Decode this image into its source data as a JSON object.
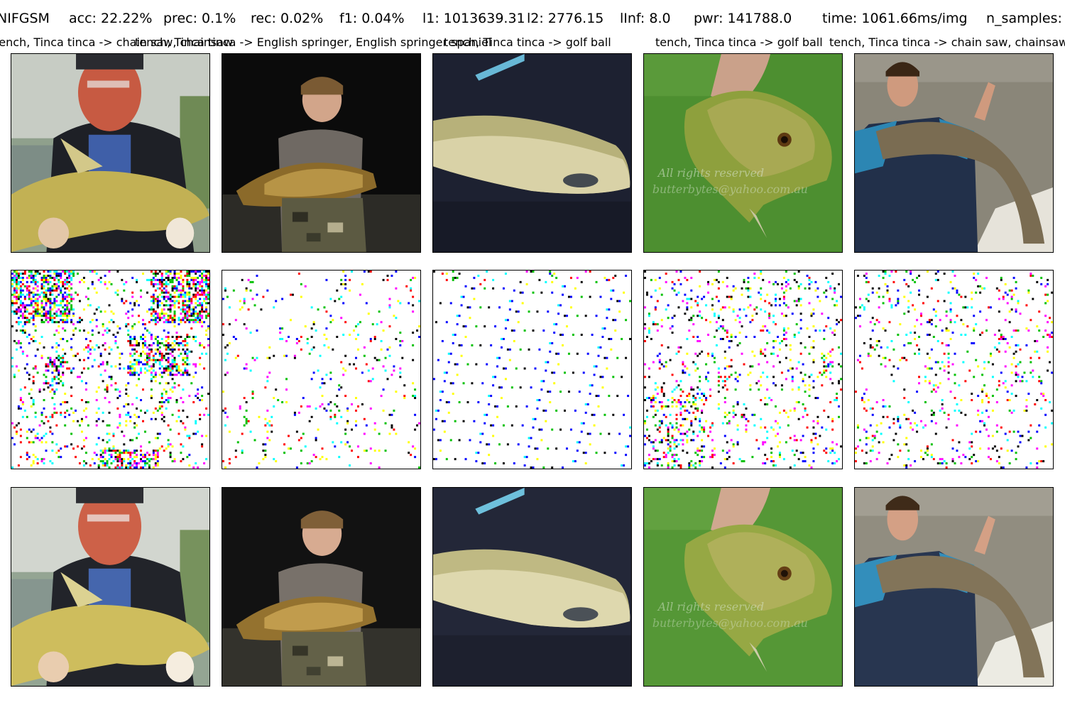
{
  "figure": {
    "header": {
      "method": "NIFGSM",
      "acc": "acc: 22.22%",
      "prec": "prec: 0.1%",
      "rec": "rec: 0.02%",
      "f1": "f1: 0.04%",
      "l1": "l1: 1013639.31",
      "l2": "l2: 2776.15",
      "linf": "lInf: 8.0",
      "pwr": "pwr: 141788.0",
      "time": "time: 1061.66ms/img",
      "n_samples": "n_samples:"
    },
    "columns": [
      {
        "caption": "tench, Tinca tinca -> chain saw, chainsaw"
      },
      {
        "caption": "tench, Tinca tinca -> English springer, English springer spaniel"
      },
      {
        "caption": "tench, Tinca tinca -> golf ball"
      },
      {
        "caption": "tench, Tinca tinca -> golf ball"
      },
      {
        "caption": "tench, Tinca tinca -> chain saw, chainsaw"
      }
    ],
    "rows": [
      {
        "role": "original"
      },
      {
        "role": "perturbation"
      },
      {
        "role": "adversarial"
      }
    ],
    "colors": {
      "noise": [
        "#ff00ff",
        "#00ffff",
        "#ffff00",
        "#0000ff",
        "#ff0000",
        "#00c000",
        "#000000"
      ],
      "background": "#ffffff"
    }
  }
}
